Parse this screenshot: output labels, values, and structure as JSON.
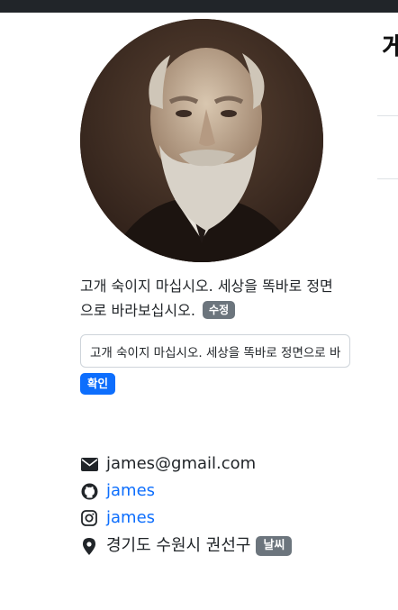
{
  "profile": {
    "avatar_icon": "portrait-photo",
    "bio": "고개 숙이지 마십시오. 세상을 똑바로 정면으로 바라보십시오.",
    "edit_label": "수정",
    "input_value": "고개 숙이지 마십시오. 세상을 똑바로 정면으로 바라보십시오.",
    "confirm_label": "확인"
  },
  "right_panel": {
    "heading": "게"
  },
  "contacts": {
    "email": {
      "icon": "envelope-icon",
      "text": "james@gmail.com"
    },
    "github": {
      "icon": "github-icon",
      "text": "james"
    },
    "instagram": {
      "icon": "instagram-icon",
      "text": "james"
    },
    "location": {
      "icon": "map-pin-icon",
      "text": "경기도 수원시 권선구",
      "weather_label": "날씨"
    }
  },
  "colors": {
    "topbar": "#212529",
    "primary": "#0d6efd",
    "secondary_badge": "#6c757d",
    "link": "#0d6efd"
  }
}
